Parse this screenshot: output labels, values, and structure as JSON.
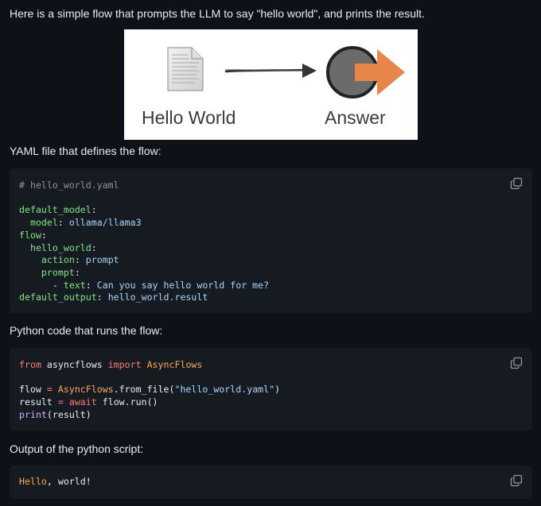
{
  "intro_text": "Here is a simple flow that prompts the LLM to say \"hello world\", and prints the result.",
  "hero": {
    "left_label": "Hello World",
    "right_label": "Answer",
    "colors": {
      "arrow_orange": "#e8864a",
      "circle_gray": "#6b6b6b"
    },
    "icons": [
      "document-icon",
      "arrow-right-icon",
      "answer-icon"
    ]
  },
  "yaml_heading": "YAML file that defines the flow:",
  "yaml_code": {
    "line1": "# hello_world.yaml",
    "l_default_model_key": "default_model",
    "l_model_key": "model",
    "l_model_val": "ollama/llama3",
    "l_flow_key": "flow",
    "l_hello_key": "hello_world",
    "l_action_key": "action",
    "l_action_val": "prompt",
    "l_prompt_key": "prompt",
    "l_text_key": "text",
    "l_text_val": "Can you say hello world for me?",
    "l_output_key": "default_output",
    "l_output_val": "hello_world.result"
  },
  "python_heading": "Python code that runs the flow:",
  "python_code": {
    "from_kw": "from",
    "module": "asyncflows",
    "import_kw": "import",
    "cls": "AsyncFlows",
    "flow_var": "flow",
    "eq": "=",
    "cls2": "AsyncFlows",
    "method": ".from_file(",
    "str": "\"hello_world.yaml\"",
    "close": ")",
    "result_var": "result",
    "await_kw": "await",
    "run_call": "flow.run()",
    "print_fn": "print",
    "print_args": "(result)"
  },
  "output_heading": "Output of the python script:",
  "output_code": {
    "hello": "Hello",
    "rest": ", world!"
  },
  "copy_icon": "copy-icon"
}
